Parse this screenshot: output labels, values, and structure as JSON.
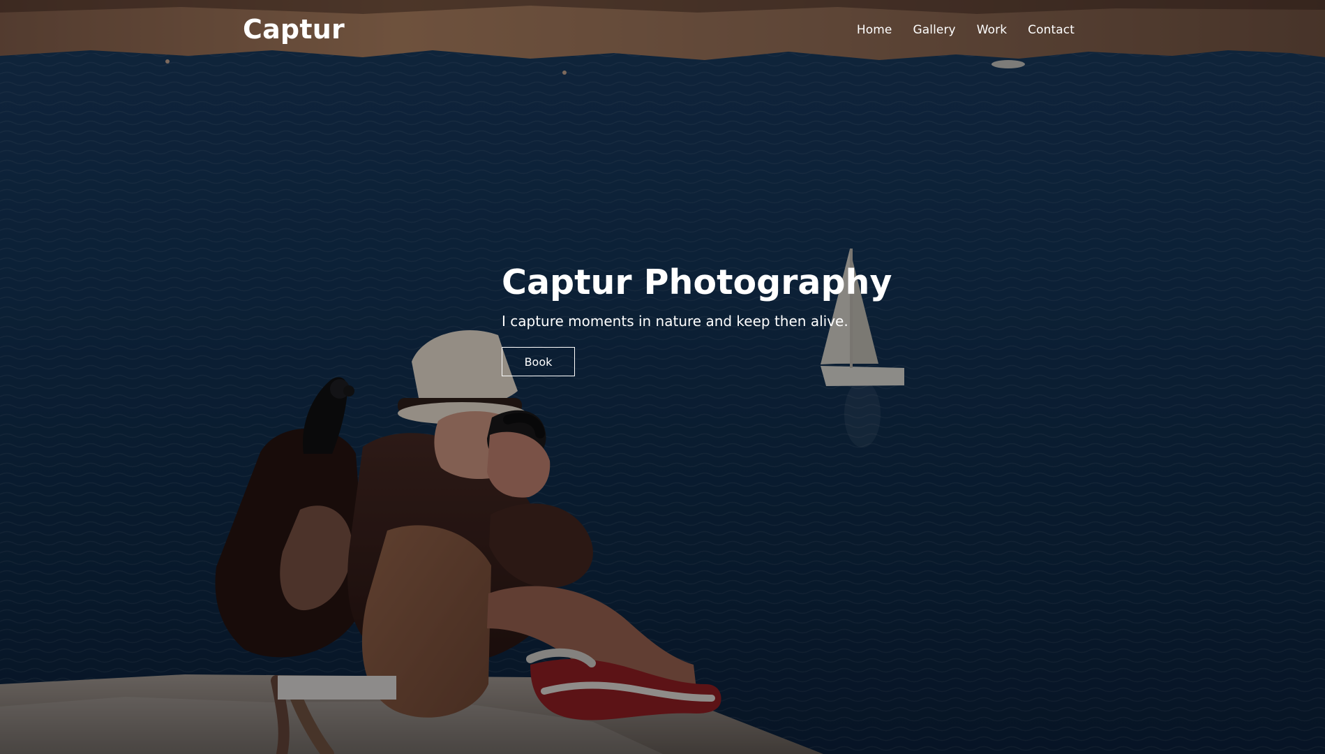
{
  "site": {
    "logo_text": "Captur",
    "nav_items": [
      {
        "label": "Home"
      },
      {
        "label": "Gallery"
      },
      {
        "label": "Work"
      },
      {
        "label": "Contact"
      }
    ]
  },
  "hero": {
    "title": "Captur Photography",
    "subtitle": "I capture moments in nature and keep then alive.",
    "cta_label": "Book"
  },
  "theme": {
    "text_color": "#ffffff",
    "overlay_color": "rgba(0,0,0,0.42)"
  }
}
